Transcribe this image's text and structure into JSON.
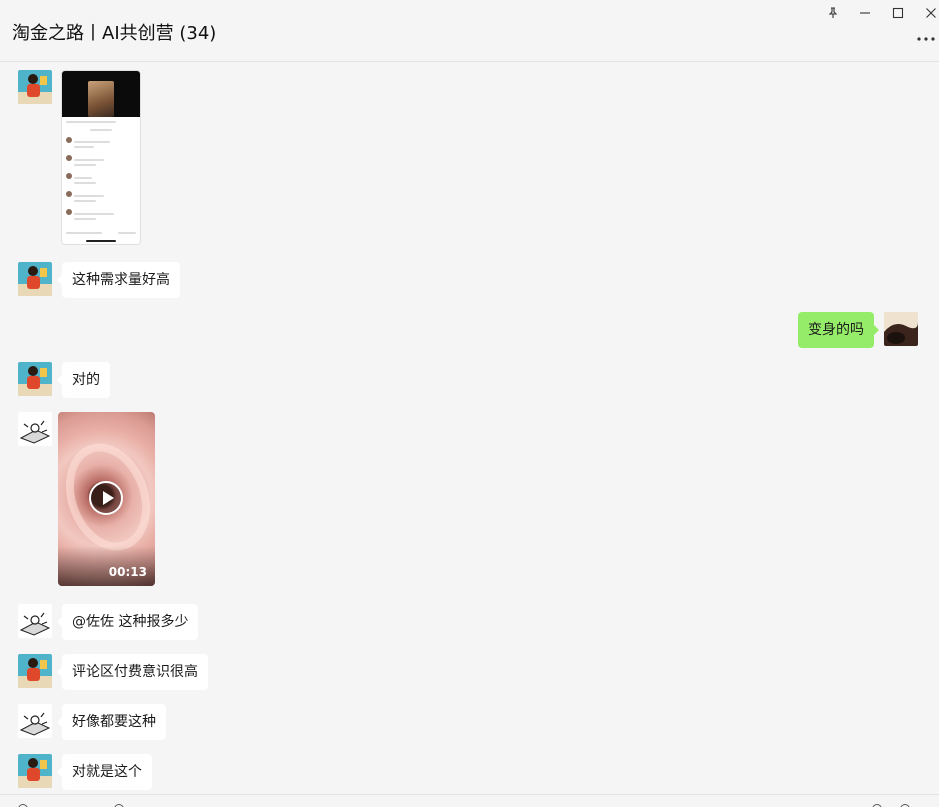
{
  "window": {
    "title": "淘金之路丨AI共创营 (34)",
    "controls": [
      "pin-icon",
      "minimize-icon",
      "maximize-icon",
      "close-icon"
    ],
    "more_icon": "more-dots-icon"
  },
  "messages": [
    {
      "side": "in",
      "sender_avatar": "avatar-child-kite",
      "type": "image",
      "description_icon": "phone-screenshot-image"
    },
    {
      "side": "in",
      "sender_avatar": "avatar-child-kite",
      "type": "text",
      "text": "这种需求量好高"
    },
    {
      "side": "out",
      "sender_avatar": "avatar-self",
      "type": "text",
      "text": "变身的吗"
    },
    {
      "side": "in",
      "sender_avatar": "avatar-child-kite",
      "type": "text",
      "text": "对的"
    },
    {
      "side": "in",
      "sender_avatar": "avatar-sketch",
      "type": "video",
      "duration": "00:13"
    },
    {
      "side": "in",
      "sender_avatar": "avatar-sketch",
      "type": "text",
      "text": "@佐佐 这种报多少"
    },
    {
      "side": "in",
      "sender_avatar": "avatar-child-kite",
      "type": "text",
      "text": "评论区付费意识很高"
    },
    {
      "side": "in",
      "sender_avatar": "avatar-sketch",
      "type": "text",
      "text": "好像都要这种"
    },
    {
      "side": "in",
      "sender_avatar": "avatar-child-kite",
      "type": "text",
      "text": "对就是这个"
    }
  ],
  "colors": {
    "background": "#f5f5f5",
    "incoming_bubble": "#ffffff",
    "outgoing_bubble": "#95ec69"
  }
}
